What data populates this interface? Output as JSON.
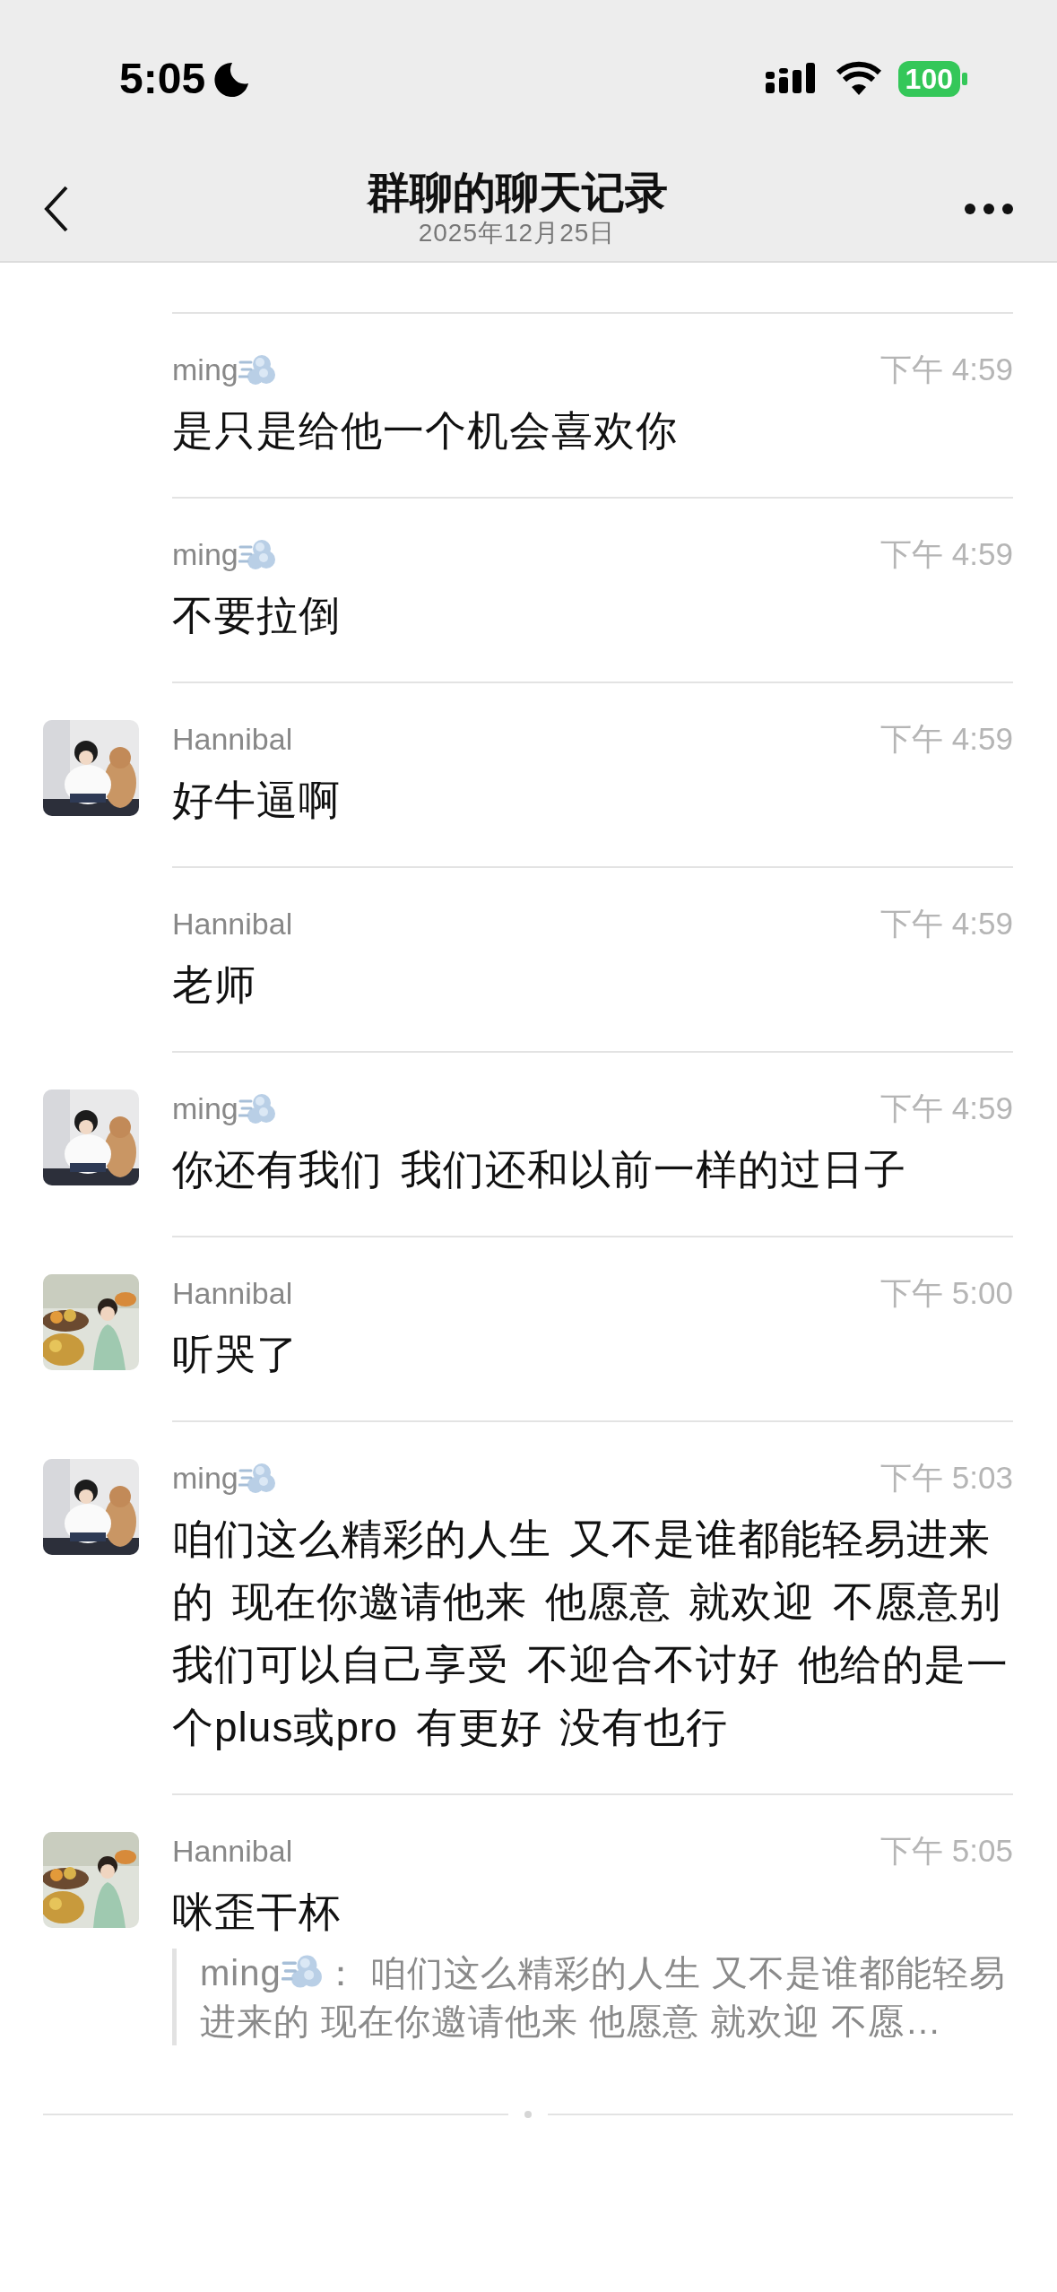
{
  "status_bar": {
    "time": "5:05",
    "battery": "100"
  },
  "nav": {
    "title": "群聊的聊天记录",
    "subtitle": "2025年12月25日"
  },
  "messages": [
    {
      "sender": "ming",
      "sender_icon": true,
      "time": "下午 4:59",
      "text": "是只是给他一个机会喜欢你",
      "avatar": false
    },
    {
      "sender": "ming",
      "sender_icon": true,
      "time": "下午 4:59",
      "text": "不要拉倒",
      "avatar": false
    },
    {
      "sender": "Hannibal",
      "time": "下午 4:59",
      "text": "好牛逼啊",
      "avatar": true
    },
    {
      "sender": "Hannibal",
      "time": "下午 4:59",
      "text": "老师",
      "avatar": false
    },
    {
      "sender": "ming",
      "sender_icon": true,
      "time": "下午 4:59",
      "text": "你还有我们 我们还和以前一样的过日子",
      "avatar": true
    },
    {
      "sender": "Hannibal",
      "time": "下午 5:00",
      "text": "听哭了",
      "avatar": true
    },
    {
      "sender": "ming",
      "sender_icon": true,
      "time": "下午 5:03",
      "text": "咱们这么精彩的人生 又不是谁都能轻易进来的 现在你邀请他来 他愿意 就欢迎 不愿意别我们可以自己享受 不迎合不讨好 他给的是一个plus或pro 有更好 没有也行",
      "avatar": true
    },
    {
      "sender": "Hannibal",
      "time": "下午 5:05",
      "text": "咪歪干杯",
      "avatar": true,
      "quote": {
        "sender": "ming",
        "sender_icon": true,
        "separator": "：",
        "text": "咱们这么精彩的人生 又不是谁都能轻易进来的 现在你邀请他来 他愿意 就欢迎 不愿…"
      }
    }
  ]
}
